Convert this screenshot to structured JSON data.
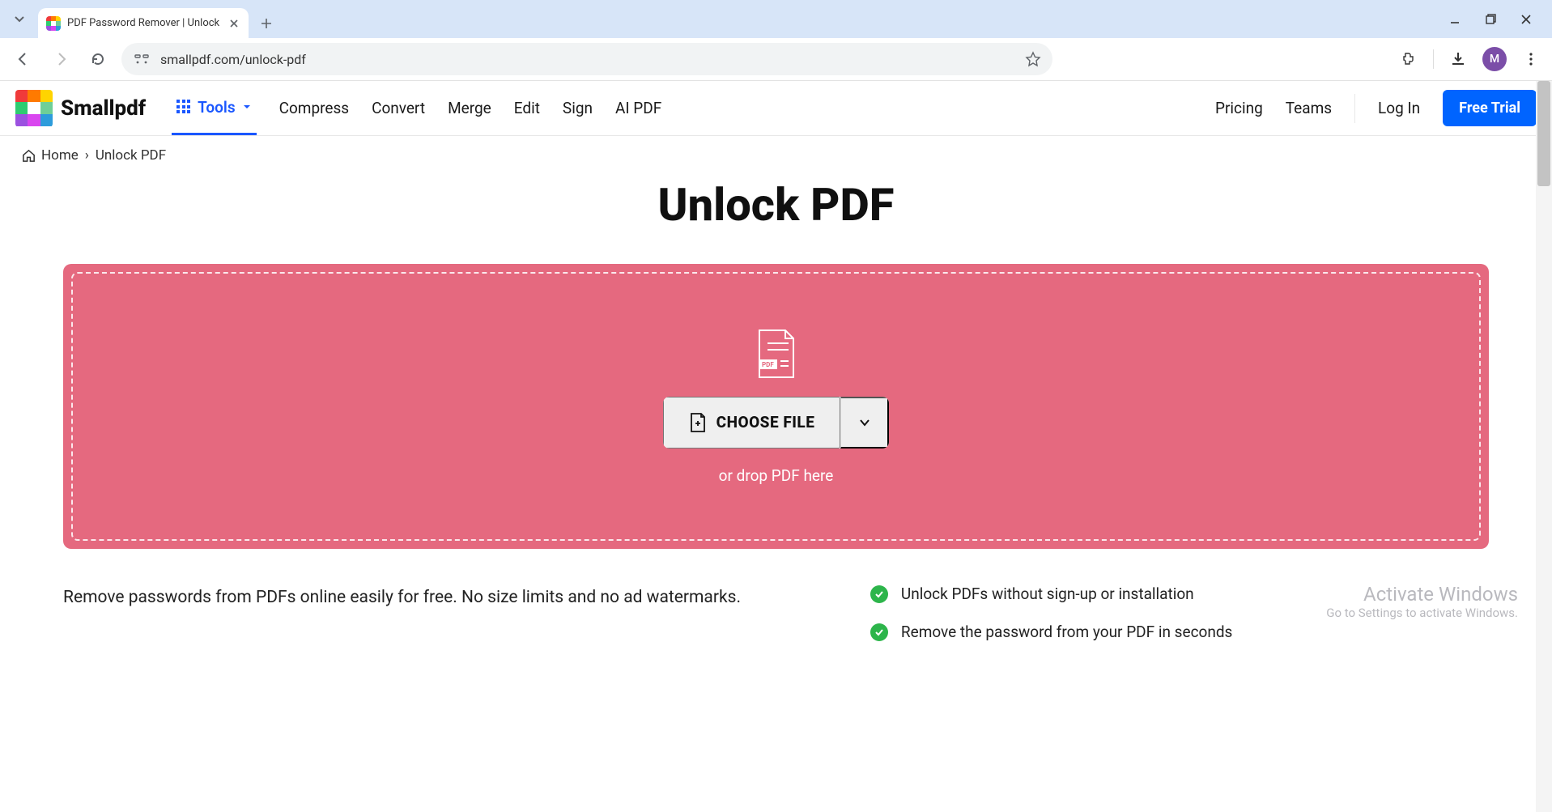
{
  "browser": {
    "tab_title": "PDF Password Remover | Unlock",
    "url": "smallpdf.com/unlock-pdf",
    "avatar_letter": "M"
  },
  "header": {
    "brand": "Smallpdf",
    "nav": {
      "tools": "Tools",
      "compress": "Compress",
      "convert": "Convert",
      "merge": "Merge",
      "edit": "Edit",
      "sign": "Sign",
      "ai_pdf": "AI PDF",
      "pricing": "Pricing",
      "teams": "Teams",
      "login": "Log In",
      "free_trial": "Free Trial"
    }
  },
  "breadcrumb": {
    "home": "Home",
    "sep": "›",
    "current": "Unlock PDF"
  },
  "main": {
    "title": "Unlock PDF",
    "choose_file": "CHOOSE FILE",
    "drop_hint": "or drop PDF here",
    "pdf_badge": "PDF"
  },
  "bottom": {
    "description": "Remove passwords from PDFs online easily for free. No size limits and no ad watermarks.",
    "features": [
      "Unlock PDFs without sign-up or installation",
      "Remove the password from your PDF in seconds"
    ]
  },
  "watermark": {
    "line1": "Activate Windows",
    "line2": "Go to Settings to activate Windows."
  },
  "colors": {
    "accent_blue": "#0064ff",
    "dropzone_pink": "#e5697f",
    "check_green": "#2db54b"
  }
}
